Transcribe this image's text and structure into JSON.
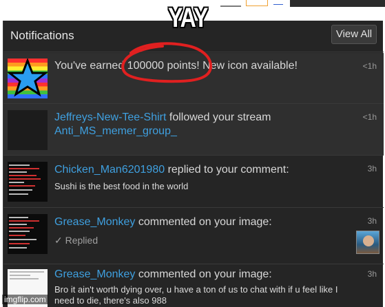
{
  "meme": {
    "caption": "YAY",
    "watermark": "imgflip.com"
  },
  "header": {
    "title": "Notifications",
    "view_all_label": "View All"
  },
  "notifications": [
    {
      "text_before": "You've earned ",
      "points": "100000 points!",
      "text_after": " New icon available!",
      "time": "<1h",
      "thumb": "rainbow-star-icon"
    },
    {
      "user": "Jeffreys-New-Tee-Shirt",
      "action": " followed your stream",
      "stream": "Anti_MS_memer_group_",
      "time": "<1h"
    },
    {
      "user": "Chicken_Man6201980",
      "action": " replied to your comment:",
      "comment": "Sushi is the best food in the world",
      "time": "3h"
    },
    {
      "user": "Grease_Monkey",
      "action": " commented on your image:",
      "status": "Replied",
      "time": "3h"
    },
    {
      "user": "Grease_Monkey",
      "action": " commented on your image:",
      "comment": "Bro it ain't worth dying over, u have a ton of us to chat with if u feel like I need to die, there's also 988",
      "time": "3h"
    }
  ],
  "colors": {
    "panel_bg": "#252525",
    "link": "#3fa0e0",
    "highlight_circle": "#e02020"
  }
}
